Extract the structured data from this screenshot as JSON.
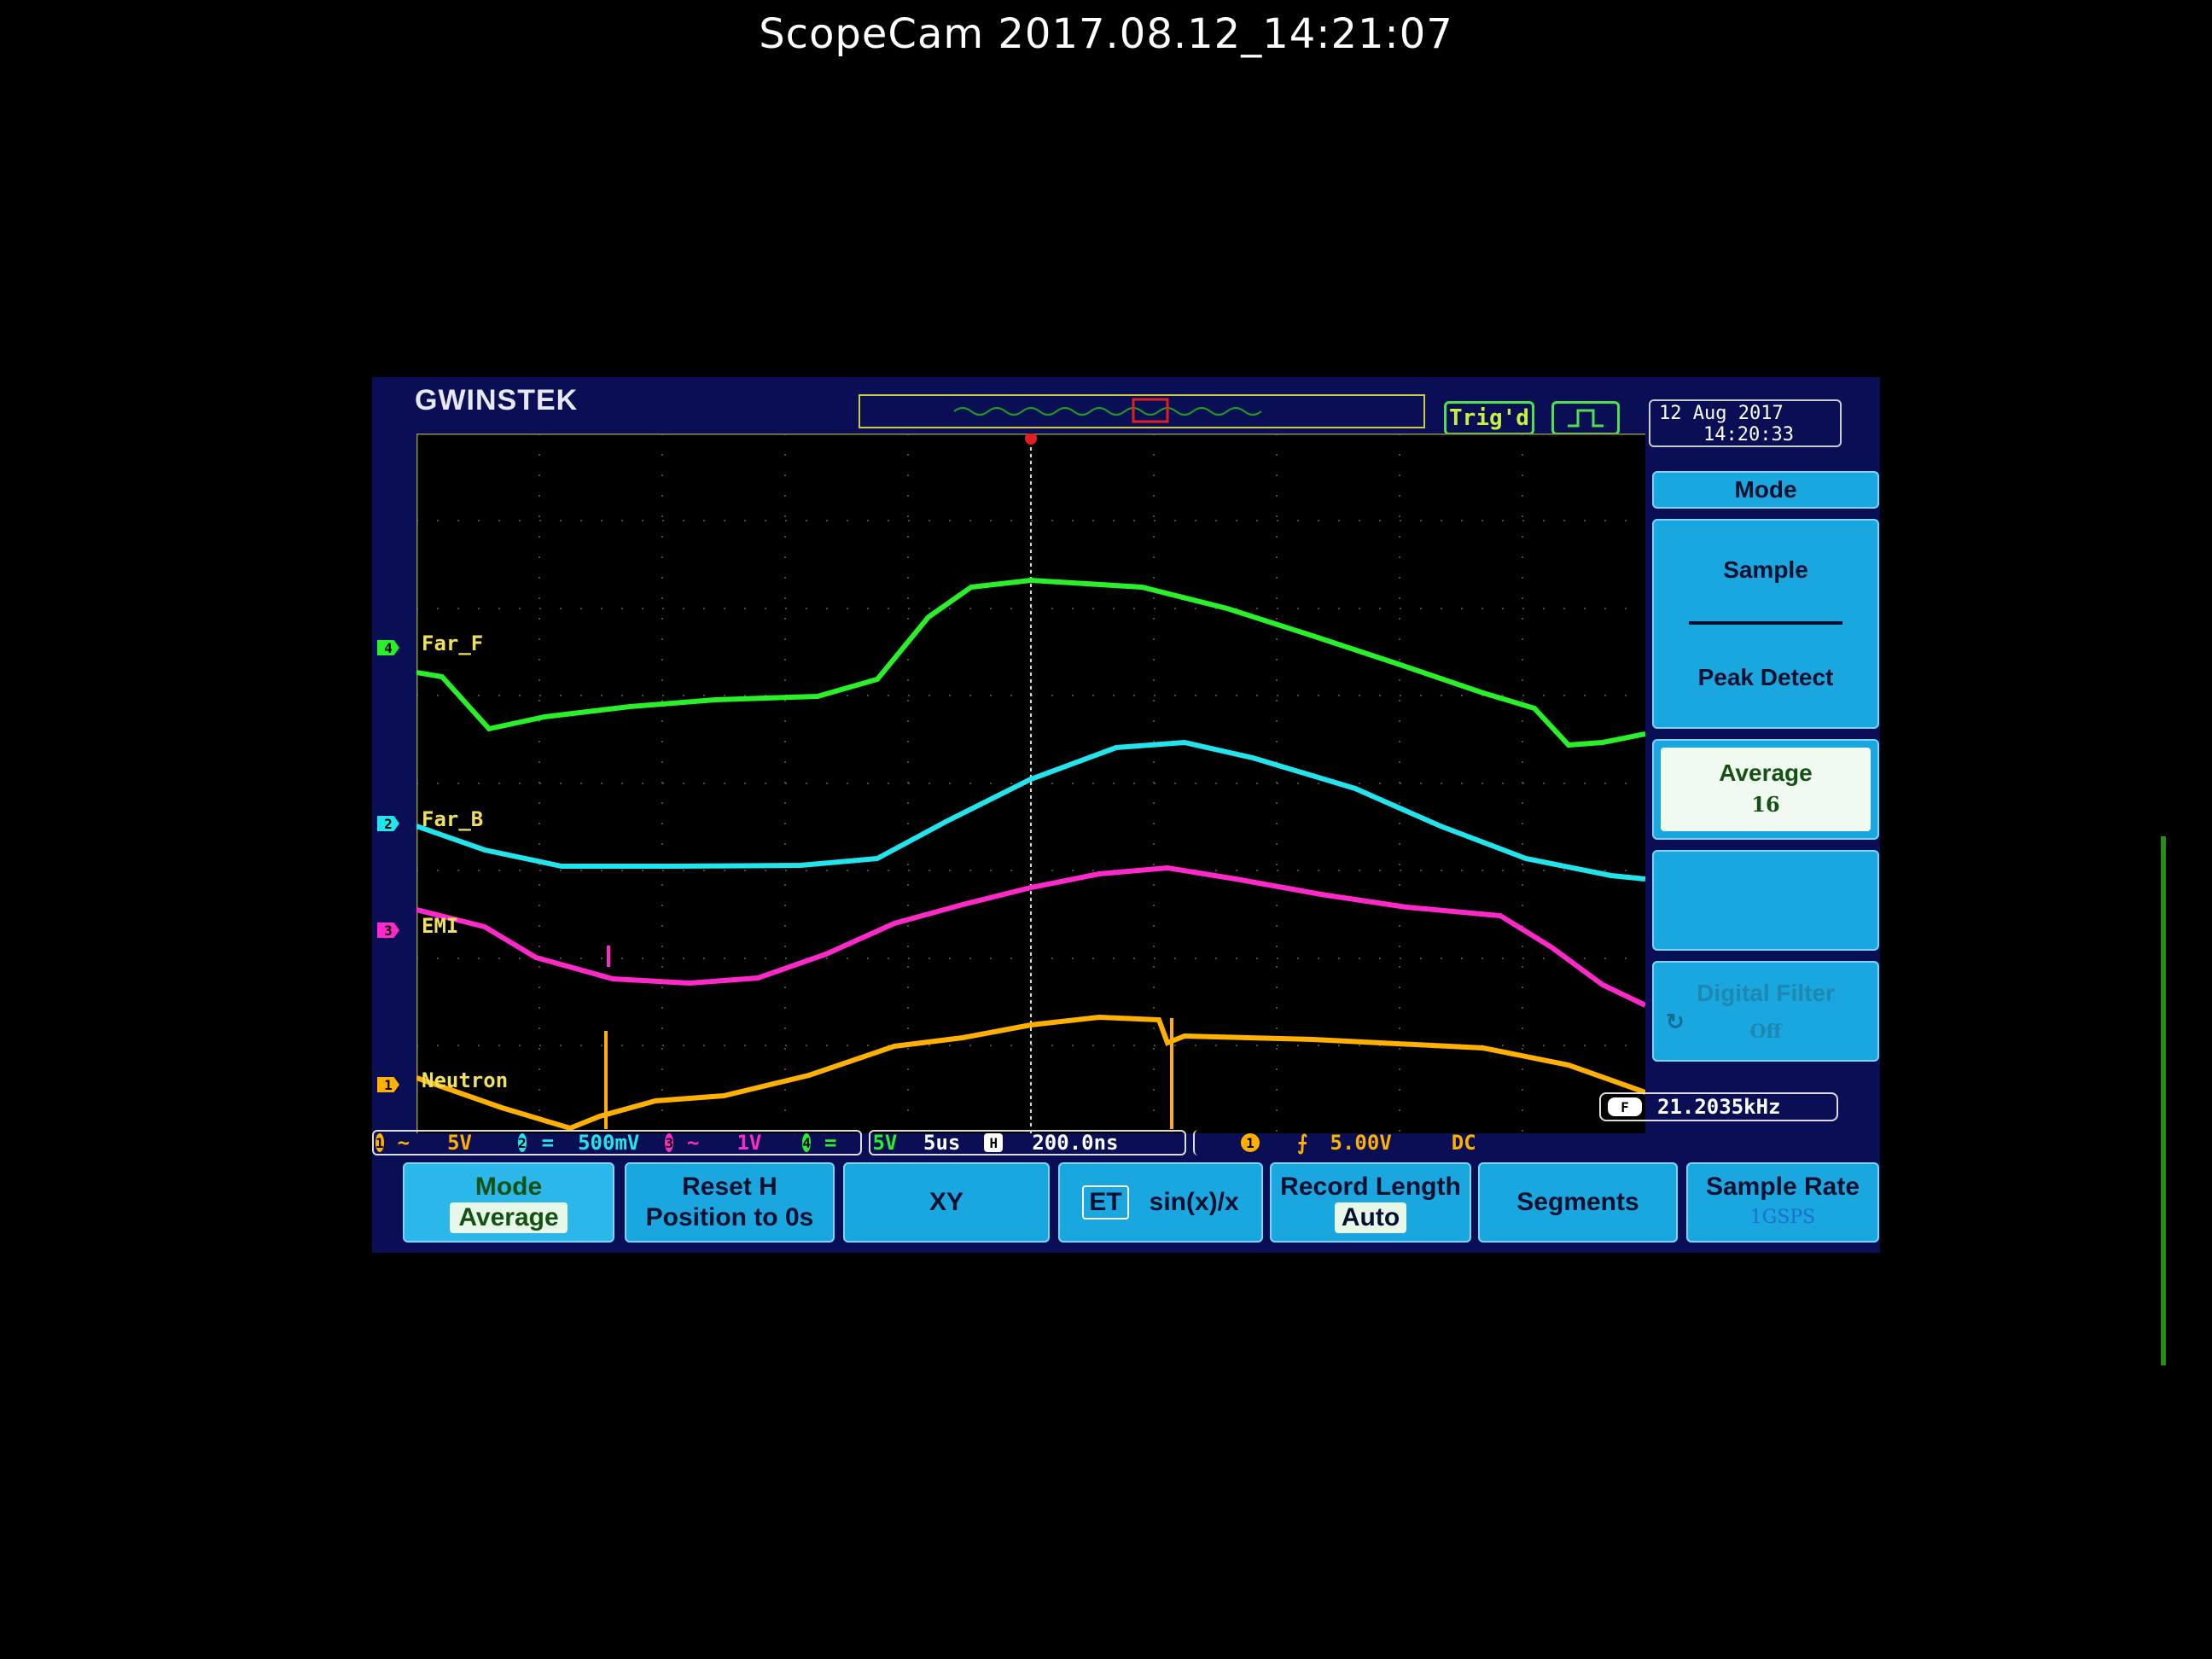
{
  "camera": {
    "title": "ScopeCam  2017.08.12_14:21:07"
  },
  "scope": {
    "brand": "GWINSTEK",
    "trigger_status": "Trig'd",
    "date": "12 Aug 2017",
    "time": "14:20:33",
    "colors": {
      "ch1": "#ffb000",
      "ch2": "#22e4ec",
      "ch3": "#ff28c8",
      "ch4": "#2af02a",
      "softkey": "#1aa7df"
    },
    "channels": [
      {
        "id": "4",
        "label": "Far_F",
        "color": "#2af02a"
      },
      {
        "id": "2",
        "label": "Far_B",
        "color": "#22e4ec"
      },
      {
        "id": "3",
        "label": "EMI",
        "color": "#ff28c8"
      },
      {
        "id": "1",
        "label": "Neutron",
        "color": "#ffb000"
      }
    ],
    "side_menu": {
      "title": "Mode",
      "option_sample": "Sample",
      "option_peak": "Peak Detect",
      "option_average": "Average",
      "average_count": "16",
      "digital_filter": "Digital Filter",
      "digital_filter_state": "Off"
    },
    "frequency": "21.2035kHz",
    "freq_icon": "F",
    "status": {
      "ch1_num": "1",
      "ch1_coupling": "~",
      "ch1_scale": "5V",
      "ch2_num": "2",
      "ch2_coupling": "=",
      "ch2_scale": "500mV",
      "ch3_num": "3",
      "ch3_coupling": "~",
      "ch3_scale": "1V",
      "ch4_num": "4",
      "ch4_coupling": "=",
      "ch4_scale": "5V",
      "timebase": "5us",
      "record_icon": "H",
      "sample_interval": "200.0ns",
      "trig_source": "1",
      "trig_level": "5.00V",
      "trig_coupling": "DC"
    },
    "softkeys": [
      {
        "line1": "Mode",
        "line2": "Average"
      },
      {
        "line1": "Reset H",
        "line2": "Position to 0s"
      },
      {
        "line1": "XY"
      },
      {
        "badge": "ET",
        "line1": "sin(x)/x"
      },
      {
        "line1": "Record Length",
        "line2": "Auto"
      },
      {
        "line1": "Segments"
      },
      {
        "line1": "Sample Rate",
        "line2": "1GSPS"
      }
    ]
  }
}
